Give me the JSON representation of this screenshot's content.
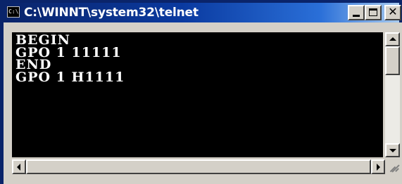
{
  "window": {
    "title": "C:\\WINNT\\system32\\telnet",
    "icon_text": "C:\\"
  },
  "console": {
    "lines": [
      "BEGIN",
      "GPO 1 11111",
      "END",
      "GPO 1 H1111"
    ]
  },
  "icons": {
    "app": "console-window-icon",
    "minimize": "minimize-icon",
    "maximize": "maximize-icon",
    "close": "close-icon",
    "scroll_up": "arrow-up-icon",
    "scroll_down": "arrow-down-icon",
    "scroll_left": "arrow-left-icon",
    "scroll_right": "arrow-right-icon",
    "resize_grip": "resize-grip-icon"
  },
  "colors": {
    "titlebar_start": "#0a246a",
    "titlebar_end": "#a6caf0",
    "console_bg": "#000000",
    "console_text": "#ffffff",
    "chrome": "#d4d0c8"
  }
}
